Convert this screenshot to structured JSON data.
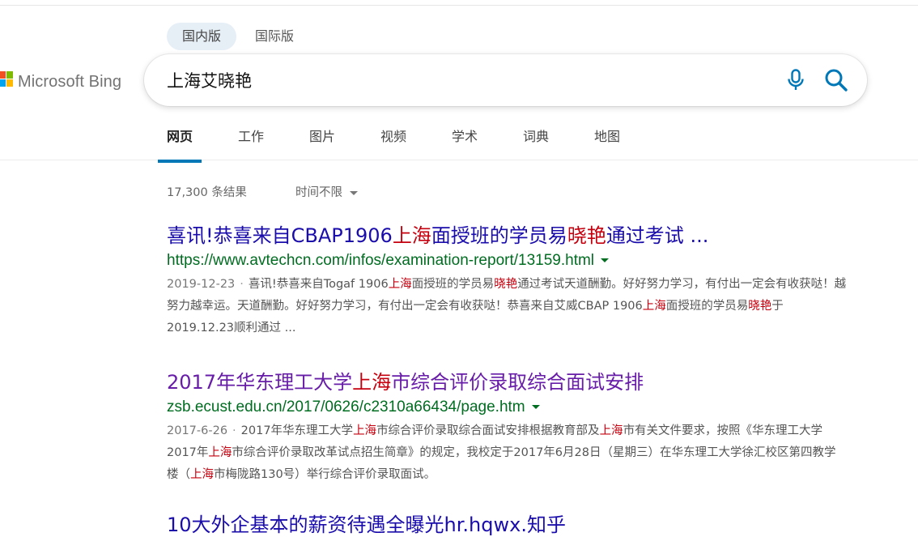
{
  "brand": {
    "name": "Microsoft Bing"
  },
  "market_tabs": [
    {
      "label": "国内版",
      "active": true
    },
    {
      "label": "国际版",
      "active": false
    }
  ],
  "search": {
    "query": "上海艾晓艳"
  },
  "scopes": [
    {
      "label": "网页",
      "active": true
    },
    {
      "label": "工作",
      "active": false
    },
    {
      "label": "图片",
      "active": false
    },
    {
      "label": "视频",
      "active": false
    },
    {
      "label": "学术",
      "active": false
    },
    {
      "label": "词典",
      "active": false
    },
    {
      "label": "地图",
      "active": false
    }
  ],
  "results_meta": {
    "count": "17,300 条结果",
    "time_filter": "时间不限"
  },
  "results": [
    {
      "title": [
        {
          "t": "喜讯!恭喜来自CBAP1906",
          "h": false
        },
        {
          "t": "上海",
          "h": true
        },
        {
          "t": "面授班的学员易",
          "h": false
        },
        {
          "t": "晓艳",
          "h": true
        },
        {
          "t": "通过考试 ...",
          "h": false
        }
      ],
      "url": "https://www.avtechcn.com/infos/examination-report/13159.html",
      "date": "2019-12-23",
      "snippet": [
        {
          "t": "喜讯!恭喜来自Togaf 1906",
          "h": false
        },
        {
          "t": "上海",
          "h": true
        },
        {
          "t": "面授班的学员易",
          "h": false
        },
        {
          "t": "晓艳",
          "h": true
        },
        {
          "t": "通过考试天道酬勤。好好努力学习，有付出一定会有收获哒！越努力越幸运。天道酬勤。好好努力学习，有付出一定会有收获哒！恭喜来自艾威CBAP 1906",
          "h": false
        },
        {
          "t": "上海",
          "h": true
        },
        {
          "t": "面授班的学员易",
          "h": false
        },
        {
          "t": "晓艳",
          "h": true
        },
        {
          "t": "于2019.12.23顺利通过 ...",
          "h": false
        }
      ]
    },
    {
      "title": [
        {
          "t": "2017年华东理工大学",
          "h": false
        },
        {
          "t": "上海",
          "h": true
        },
        {
          "t": "市综合评价录取综合面试安排",
          "h": false
        }
      ],
      "url": "zsb.ecust.edu.cn/2017/0626/c2310a66434/page.htm",
      "date": "2017-6-26",
      "snippet": [
        {
          "t": "2017年华东理工大学",
          "h": false
        },
        {
          "t": "上海",
          "h": true
        },
        {
          "t": "市综合评价录取综合面试安排根据教育部及",
          "h": false
        },
        {
          "t": "上海",
          "h": true
        },
        {
          "t": "市有关文件要求，按照《华东理工大学2017年",
          "h": false
        },
        {
          "t": "上海",
          "h": true
        },
        {
          "t": "市综合评价录取改革试点招生简章》的规定，我校定于2017年6月28日（星期三）在华东理工大学徐汇校区第四教学楼（",
          "h": false
        },
        {
          "t": "上海",
          "h": true
        },
        {
          "t": "市梅陇路130号）举行综合评价录取面试。",
          "h": false
        }
      ]
    }
  ],
  "next_result_partial": "10大外企基本的薪资待遇全曝光hr.hqwx.知乎"
}
